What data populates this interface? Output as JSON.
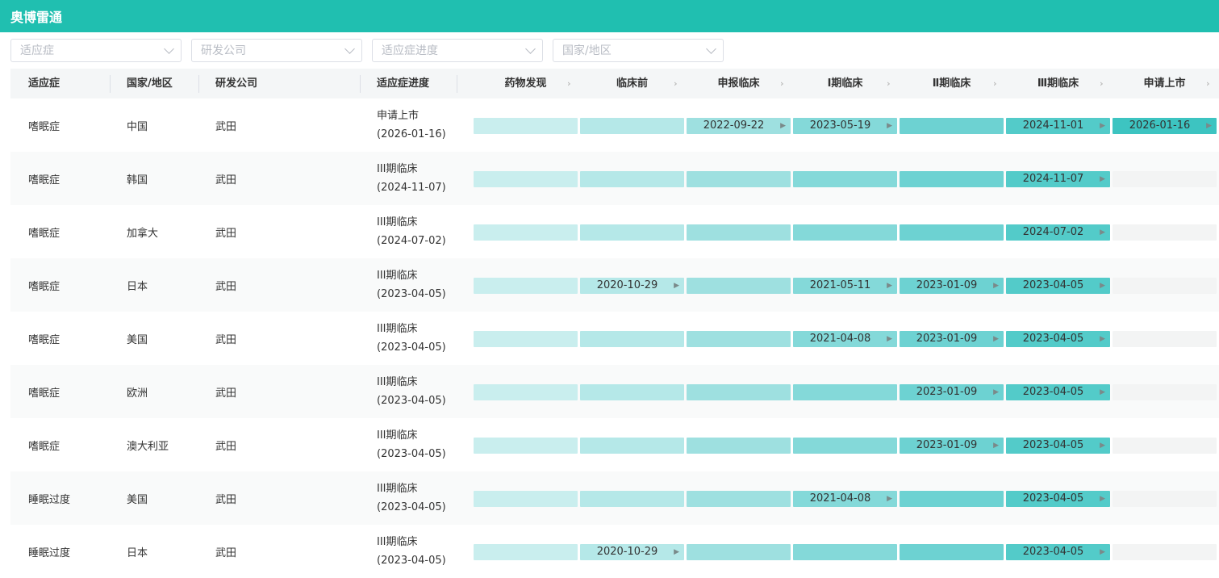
{
  "app": {
    "title": "奥博雷通"
  },
  "filters": [
    {
      "placeholder": "适应症"
    },
    {
      "placeholder": "研发公司"
    },
    {
      "placeholder": "适应症进度"
    },
    {
      "placeholder": "国家/地区"
    }
  ],
  "columns": {
    "indication": "适应症",
    "country": "国家/地区",
    "company": "研发公司",
    "progress": "适应症进度"
  },
  "stages": [
    "药物发现",
    "临床前",
    "申报临床",
    "Ⅰ期临床",
    "Ⅱ期临床",
    "Ⅲ期临床",
    "申请上市"
  ],
  "stage_colors": [
    "#c9eeee",
    "#b5e8e8",
    "#9ee0e0",
    "#84d9d9",
    "#6dd2d2",
    "#53cbc9",
    "#3dc4c1"
  ],
  "empty_color": "#f3f4f4",
  "rows": [
    {
      "indication": "嗜眠症",
      "country": "中国",
      "company": "武田",
      "progress_stage": "申请上市",
      "progress_date": "(2026-01-16)",
      "reached": 7,
      "dates": [
        "",
        "",
        "2022-09-22",
        "2023-05-19",
        "",
        "2024-11-01",
        "2026-01-16"
      ]
    },
    {
      "indication": "嗜眠症",
      "country": "韩国",
      "company": "武田",
      "progress_stage": "III期临床",
      "progress_date": "(2024-11-07)",
      "reached": 6,
      "dates": [
        "",
        "",
        "",
        "",
        "",
        "2024-11-07",
        ""
      ]
    },
    {
      "indication": "嗜眠症",
      "country": "加拿大",
      "company": "武田",
      "progress_stage": "III期临床",
      "progress_date": "(2024-07-02)",
      "reached": 6,
      "dates": [
        "",
        "",
        "",
        "",
        "",
        "2024-07-02",
        ""
      ]
    },
    {
      "indication": "嗜眠症",
      "country": "日本",
      "company": "武田",
      "progress_stage": "III期临床",
      "progress_date": "(2023-04-05)",
      "reached": 6,
      "dates": [
        "",
        "2020-10-29",
        "",
        "2021-05-11",
        "2023-01-09",
        "2023-04-05",
        ""
      ]
    },
    {
      "indication": "嗜眠症",
      "country": "美国",
      "company": "武田",
      "progress_stage": "III期临床",
      "progress_date": "(2023-04-05)",
      "reached": 6,
      "dates": [
        "",
        "",
        "",
        "2021-04-08",
        "2023-01-09",
        "2023-04-05",
        ""
      ]
    },
    {
      "indication": "嗜眠症",
      "country": "欧洲",
      "company": "武田",
      "progress_stage": "III期临床",
      "progress_date": "(2023-04-05)",
      "reached": 6,
      "dates": [
        "",
        "",
        "",
        "",
        "2023-01-09",
        "2023-04-05",
        ""
      ]
    },
    {
      "indication": "嗜眠症",
      "country": "澳大利亚",
      "company": "武田",
      "progress_stage": "III期临床",
      "progress_date": "(2023-04-05)",
      "reached": 6,
      "dates": [
        "",
        "",
        "",
        "",
        "2023-01-09",
        "2023-04-05",
        ""
      ]
    },
    {
      "indication": "睡眠过度",
      "country": "美国",
      "company": "武田",
      "progress_stage": "III期临床",
      "progress_date": "(2023-04-05)",
      "reached": 6,
      "dates": [
        "",
        "",
        "",
        "2021-04-08",
        "",
        "2023-04-05",
        ""
      ]
    },
    {
      "indication": "睡眠过度",
      "country": "日本",
      "company": "武田",
      "progress_stage": "III期临床",
      "progress_date": "(2023-04-05)",
      "reached": 6,
      "dates": [
        "",
        "2020-10-29",
        "",
        "",
        "",
        "2023-04-05",
        ""
      ]
    }
  ]
}
